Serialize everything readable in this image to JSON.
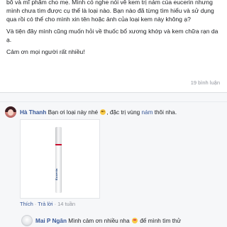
{
  "post": {
    "lines": [
      "bổ và mĩ phẩm cho mẹ. Mình có nghe nói về kem trị nám của eucerin nhưng mình chưa tìm được cụ thể là loại nào. Bạn nào đã từng tìm hiểu và sử dụng qua rồi có thể cho mình xin tên hoặc ảnh của loại kem này không ạ?",
      "Và tiện đây mình cũng muốn hỏi về thuốc bổ xương khớp và kem chữa rạn da ạ.",
      "Cảm ơn mọi người rất nhiều!"
    ],
    "comment_count": "19 bình luận"
  },
  "comment": {
    "author": "Hà Thanh",
    "text_before": "Bạn ơi loại này nhé",
    "emoji": "grin-emoji",
    "text_middle": ", đặc trị vùng",
    "highlight": "nám",
    "text_after": "thôi nha.",
    "product_label": "Eucerin",
    "like": "Thích",
    "reply": "Trả lời",
    "time": "14 tuần"
  },
  "reply": {
    "author": "Mai P Ngân",
    "text": "Mình cảm ơn nhiều nha",
    "emoji": "heart-eyes-emoji",
    "text_after": "để mình tìm thử"
  },
  "colors": {
    "link": "#385898",
    "muted": "#90949c",
    "comment_bg": "#f6f7f9"
  }
}
